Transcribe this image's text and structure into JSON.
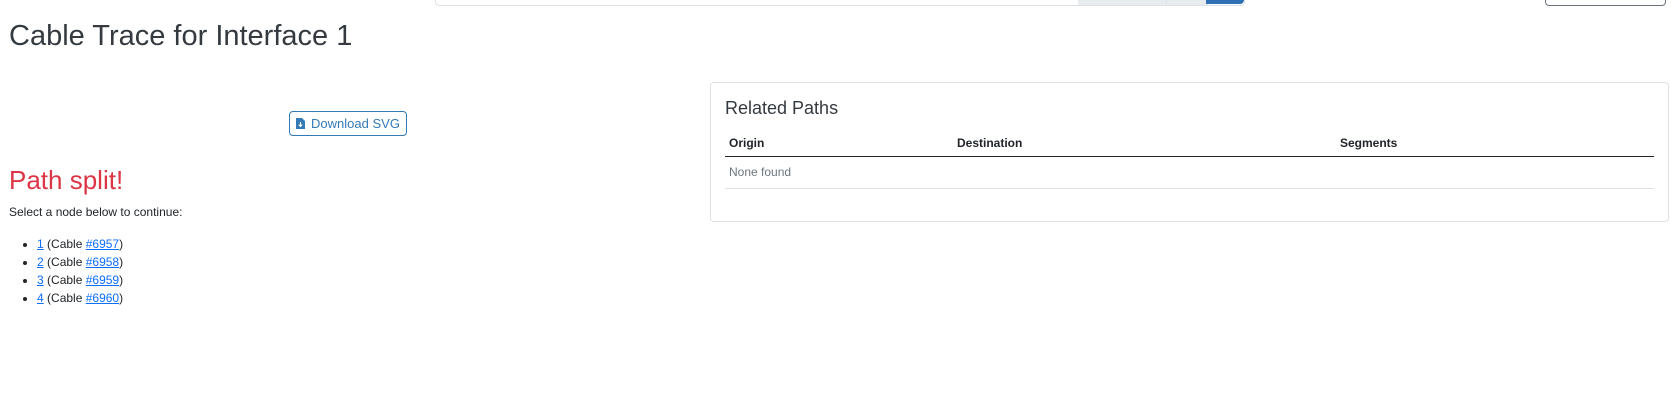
{
  "page": {
    "title": "Cable Trace for Interface 1"
  },
  "actions": {
    "download_svg": {
      "label": "Download SVG",
      "icon": "file-download-icon"
    }
  },
  "trace": {
    "split_heading": "Path split!",
    "instruction": "Select a node below to continue:",
    "nodes": [
      {
        "label": "1",
        "cable_prefix": "(Cable ",
        "cable_link": "#6957",
        "suffix": ")"
      },
      {
        "label": "2",
        "cable_prefix": "(Cable ",
        "cable_link": "#6958",
        "suffix": ")"
      },
      {
        "label": "3",
        "cable_prefix": "(Cable ",
        "cable_link": "#6959",
        "suffix": ")"
      },
      {
        "label": "4",
        "cable_prefix": "(Cable ",
        "cable_link": "#6960",
        "suffix": ")"
      }
    ]
  },
  "related_paths": {
    "title": "Related Paths",
    "columns": [
      "Origin",
      "Destination",
      "Segments"
    ],
    "empty_text": "None found"
  },
  "colors": {
    "danger": "#dc3545",
    "link": "#0d6efd",
    "button_outline": "#337ab7"
  }
}
